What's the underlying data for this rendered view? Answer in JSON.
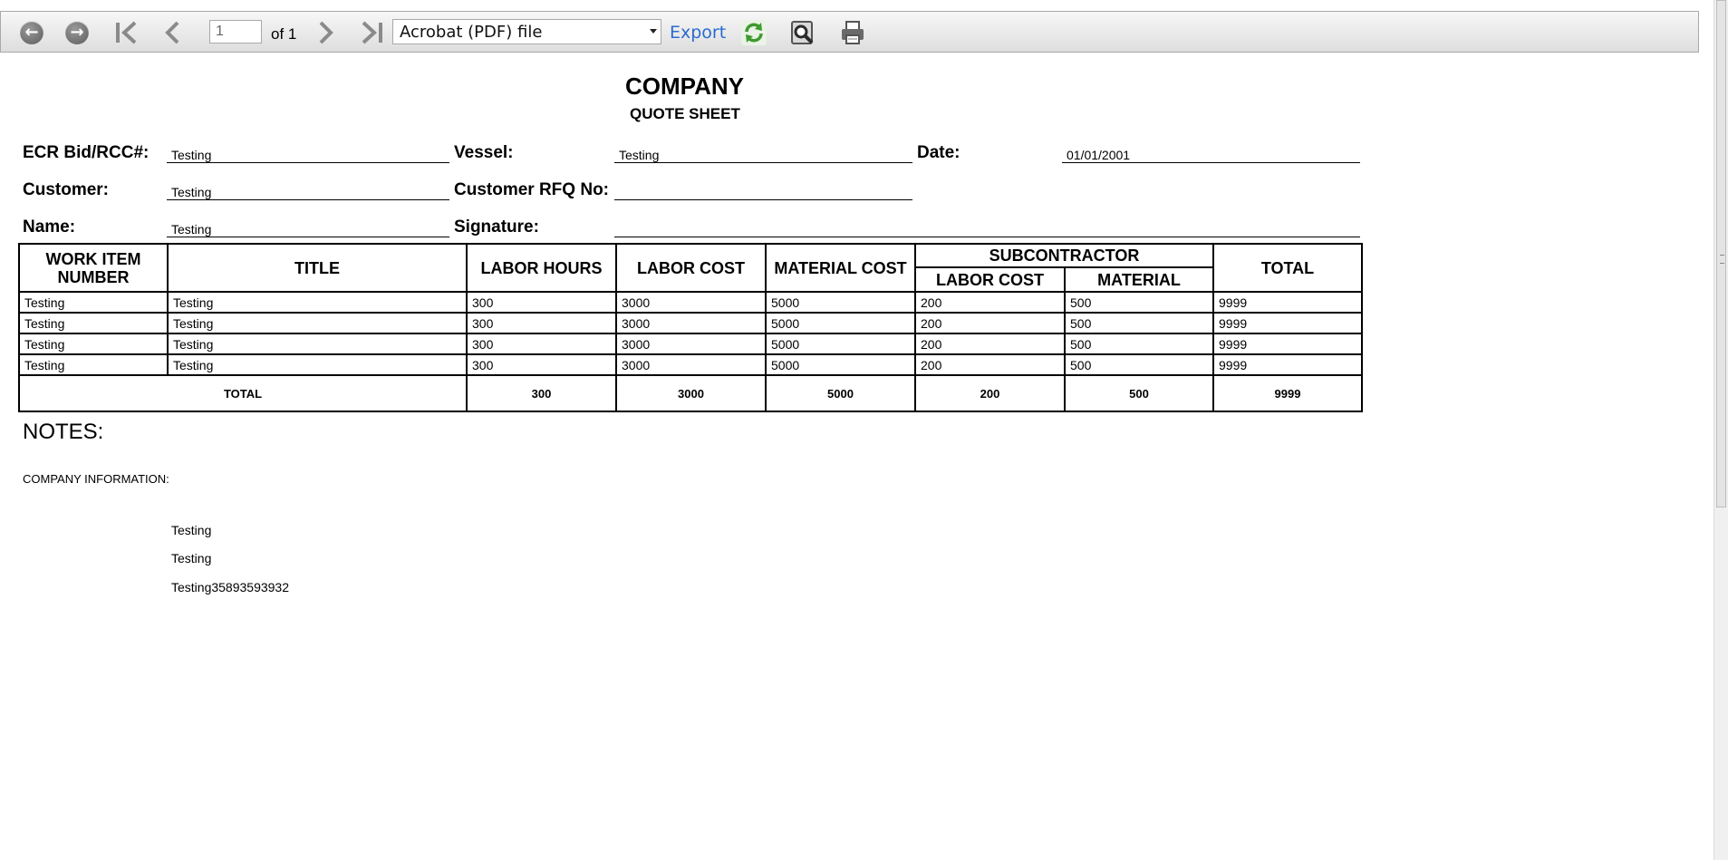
{
  "toolbar": {
    "back_icon": "back-arrow-icon",
    "forward_icon": "forward-arrow-icon",
    "first_page_icon": "first-page-icon",
    "prev_page_icon": "previous-page-icon",
    "next_page_icon": "next-page-icon",
    "last_page_icon": "last-page-icon",
    "page_value": "1",
    "page_of": "of 1",
    "format_selected": "Acrobat (PDF) file",
    "export_label": "Export",
    "refresh_icon": "refresh-icon",
    "find_icon": "find-icon",
    "print_icon": "print-icon"
  },
  "report": {
    "title": "COMPANY",
    "subtitle": "QUOTE SHEET",
    "fields": {
      "ecr_label": "ECR Bid/RCC#:",
      "ecr_value": "Testing",
      "vessel_label": "Vessel:",
      "vessel_value": "Testing",
      "date_label": "Date:",
      "date_value": "01/01/2001",
      "customer_label": "Customer:",
      "customer_value": "Testing",
      "rfq_label": "Customer RFQ No:",
      "rfq_value": "",
      "name_label": "Name:",
      "name_value": "Testing",
      "signature_label": "Signature:",
      "signature_value": ""
    },
    "table": {
      "headers": {
        "work_item": "WORK ITEM NUMBER",
        "title": "TITLE",
        "labor_hours": "LABOR HOURS",
        "labor_cost": "LABOR COST",
        "material_cost": "MATERIAL COST",
        "subcontractor": "SUBCONTRACTOR",
        "sub_labor_cost": "LABOR COST",
        "sub_material": "MATERIAL",
        "total": "TOTAL"
      },
      "rows": [
        [
          "Testing",
          "Testing",
          "300",
          "3000",
          "5000",
          "200",
          "500",
          "9999"
        ],
        [
          "Testing",
          "Testing",
          "300",
          "3000",
          "5000",
          "200",
          "500",
          "9999"
        ],
        [
          "Testing",
          "Testing",
          "300",
          "3000",
          "5000",
          "200",
          "500",
          "9999"
        ],
        [
          "Testing",
          "Testing",
          "300",
          "3000",
          "5000",
          "200",
          "500",
          "9999"
        ]
      ],
      "totals": {
        "label": "TOTAL",
        "labor_hours": "300",
        "labor_cost": "3000",
        "material_cost": "5000",
        "sub_labor_cost": "200",
        "sub_material": "500",
        "total": "9999"
      }
    },
    "notes_label": "NOTES:",
    "company_info_label": "COMPANY INFORMATION:",
    "company_info_lines": [
      "Testing",
      "Testing",
      "Testing35893593932"
    ]
  }
}
